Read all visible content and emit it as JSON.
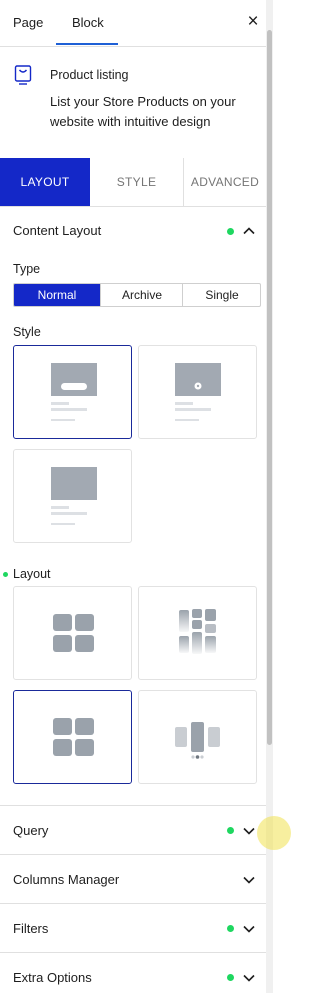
{
  "header": {
    "tabs": [
      {
        "label": "Page"
      },
      {
        "label": "Block"
      }
    ],
    "active_tab": "Block",
    "close_symbol": "×"
  },
  "block": {
    "icon": "product-bag-icon",
    "title": "Product listing",
    "description": "List your Store Products on your website with intuitive design"
  },
  "sub_tabs": [
    {
      "label": "LAYOUT"
    },
    {
      "label": "STYLE"
    },
    {
      "label": "ADVANCED"
    }
  ],
  "content_layout": {
    "title": "Content Layout",
    "type_label": "Type",
    "type_options": [
      "Normal",
      "Archive",
      "Single"
    ],
    "type_selected": "Normal",
    "style_label": "Style",
    "layout_label": "Layout"
  },
  "sections": [
    {
      "title": "Query"
    },
    {
      "title": "Columns Manager"
    },
    {
      "title": "Filters"
    },
    {
      "title": "Extra Options"
    }
  ],
  "colors": {
    "accent": "#1428c8",
    "status_dot": "#1ed760",
    "tab_underline": "#1e60d6"
  }
}
